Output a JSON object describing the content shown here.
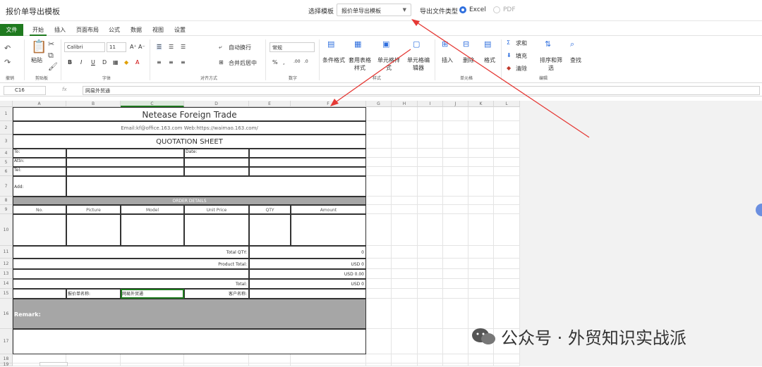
{
  "app": {
    "title": "报价单导出模板"
  },
  "header": {
    "template_label": "选择模板",
    "template_value": "报价单导出模板",
    "export_label": "导出文件类型",
    "opt_excel": "Excel",
    "opt_pdf": "PDF"
  },
  "menu": [
    "文件",
    "开始",
    "插入",
    "页面布局",
    "公式",
    "数据",
    "视图",
    "设置"
  ],
  "ribbon": {
    "paste": "粘贴",
    "font_name": "Calibri",
    "font_size": "11",
    "wrap": "自动换行",
    "merge": "合并后居中",
    "number_format": "常规",
    "cond": "条件格式",
    "table_fmt": "套用表格样式",
    "cell_style": "单元格样式",
    "cell_editor": "单元格编辑器",
    "insert": "插入",
    "delete": "删除",
    "format": "格式",
    "sum": "求和",
    "fill": "填充",
    "clear": "清除",
    "sort": "排序和筛选",
    "find": "查找",
    "groups": [
      "撤销",
      "剪贴板",
      "字体",
      "对齐方式",
      "数字",
      "样式",
      "单元格",
      "编辑"
    ]
  },
  "formula": {
    "cell": "C16",
    "fx": "fx",
    "value": "网易外贸通"
  },
  "columns": [
    "A",
    "B",
    "C",
    "D",
    "E",
    "F",
    "G",
    "H",
    "I",
    "J",
    "K",
    "L"
  ],
  "rows": [
    "1",
    "2",
    "3",
    "4",
    "5",
    "6",
    "7",
    "8",
    "9",
    "10",
    "11",
    "12",
    "13",
    "14",
    "15",
    "16",
    "17",
    "18",
    "19"
  ],
  "sheet": {
    "title": "Netease Foreign Trade",
    "contact": "Email:kf@office.163.com       Web:https://waimao.163.com/",
    "doc": "QUOTATION SHEET",
    "to": "To:",
    "date": "Date:",
    "attn": "Attn:",
    "tel": "Tel:",
    "add": "Add:",
    "order": "ORDER DETAILS",
    "h_no": "No.",
    "h_pic": "Picture",
    "h_model": "Model",
    "h_price": "Unit Price",
    "h_qty": "QTY",
    "h_amount": "Amount",
    "total_qty": "Total QTY:",
    "total_qty_v": "0",
    "product_total": "Product Total:",
    "product_total_v": "USD 0",
    "r14_v": "USD 0.00",
    "total": "Total:",
    "total_v": "USD 0",
    "r16_label": "报价单名称:",
    "r16_value": "网易外贸通",
    "r16_client": "客户名称:",
    "remark": "Remark:"
  },
  "watermark": "公众号 · 外贸知识实战派"
}
